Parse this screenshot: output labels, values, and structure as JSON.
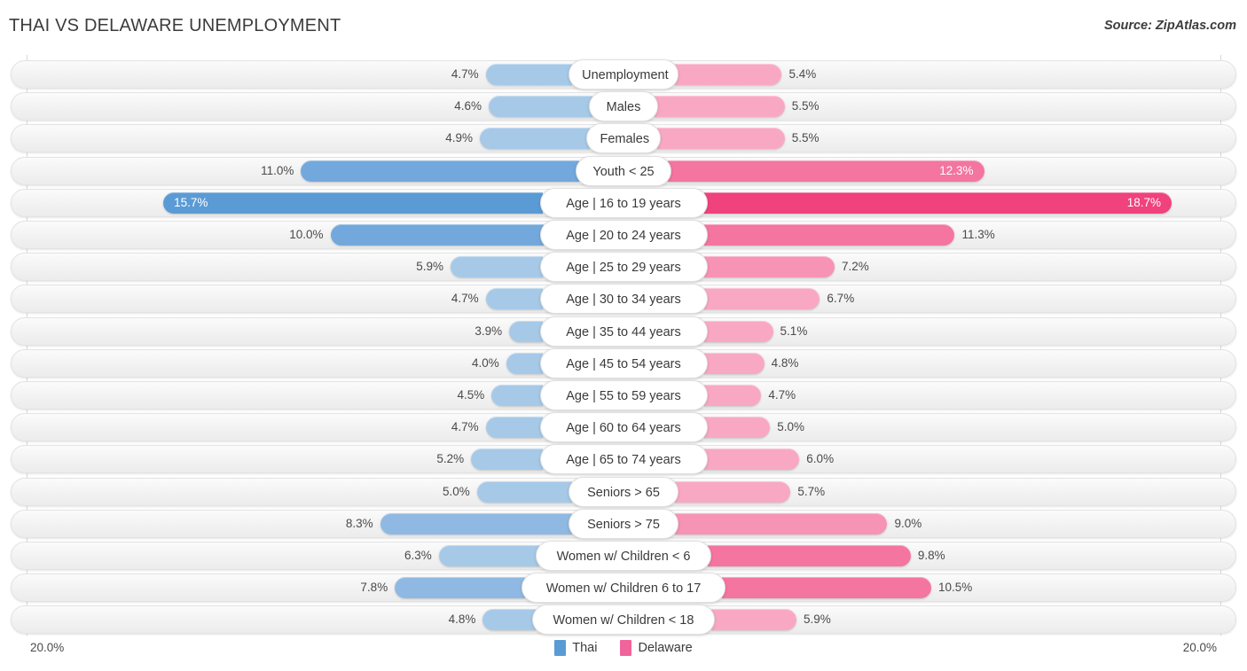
{
  "header": {
    "title": "THAI VS DELAWARE UNEMPLOYMENT",
    "source": "Source: ZipAtlas.com"
  },
  "axis": {
    "min_label": "20.0%",
    "max_label": "20.0%"
  },
  "legend": {
    "items": [
      {
        "label": "Thai",
        "color": "#5b9bd5"
      },
      {
        "label": "Delaware",
        "color": "#f0649b"
      }
    ]
  },
  "colors": {
    "thai_light": "#a6c9e8",
    "thai_mid": "#8fb9e2",
    "thai_strong": "#72a8dc",
    "thai_max": "#5b9bd5",
    "delaware_light": "#f9a8c4",
    "delaware_mid": "#f793b5",
    "delaware_strong": "#f4759f",
    "delaware_max": "#f0427d",
    "track": "#f2f2f2",
    "gridline": "#d9d9d9",
    "text": "#404040"
  },
  "chart_data": {
    "type": "bar",
    "title": "THAI VS DELAWARE UNEMPLOYMENT",
    "subtitle": "",
    "xlabel": "",
    "ylabel": "",
    "orientation": "horizontal-diverging",
    "axis_max_percent": 20.0,
    "xlim": [
      20.0,
      20.0
    ],
    "grid": true,
    "legend_position": "bottom-center",
    "categories": [
      "Unemployment",
      "Males",
      "Females",
      "Youth < 25",
      "Age | 16 to 19 years",
      "Age | 20 to 24 years",
      "Age | 25 to 29 years",
      "Age | 30 to 34 years",
      "Age | 35 to 44 years",
      "Age | 45 to 54 years",
      "Age | 55 to 59 years",
      "Age | 60 to 64 years",
      "Age | 65 to 74 years",
      "Seniors > 65",
      "Seniors > 75",
      "Women w/ Children < 6",
      "Women w/ Children 6 to 17",
      "Women w/ Children < 18"
    ],
    "series": [
      {
        "name": "Thai",
        "color": "#5b9bd5",
        "values": [
          4.7,
          4.6,
          4.9,
          11.0,
          15.7,
          10.0,
          5.9,
          4.7,
          3.9,
          4.0,
          4.5,
          4.7,
          5.2,
          5.0,
          8.3,
          6.3,
          7.8,
          4.8
        ],
        "labels": [
          "4.7%",
          "4.6%",
          "4.9%",
          "11.0%",
          "15.7%",
          "10.0%",
          "5.9%",
          "4.7%",
          "3.9%",
          "4.0%",
          "4.5%",
          "4.7%",
          "5.2%",
          "5.0%",
          "8.3%",
          "6.3%",
          "7.8%",
          "4.8%"
        ]
      },
      {
        "name": "Delaware",
        "color": "#f0649b",
        "values": [
          5.4,
          5.5,
          5.5,
          12.3,
          18.7,
          11.3,
          7.2,
          6.7,
          5.1,
          4.8,
          4.7,
          5.0,
          6.0,
          5.7,
          9.0,
          9.8,
          10.5,
          5.9
        ],
        "labels": [
          "5.4%",
          "5.5%",
          "5.5%",
          "12.3%",
          "18.7%",
          "11.3%",
          "7.2%",
          "6.7%",
          "5.1%",
          "4.8%",
          "4.7%",
          "5.0%",
          "6.0%",
          "5.7%",
          "9.0%",
          "9.8%",
          "10.5%",
          "5.9%"
        ]
      }
    ]
  }
}
